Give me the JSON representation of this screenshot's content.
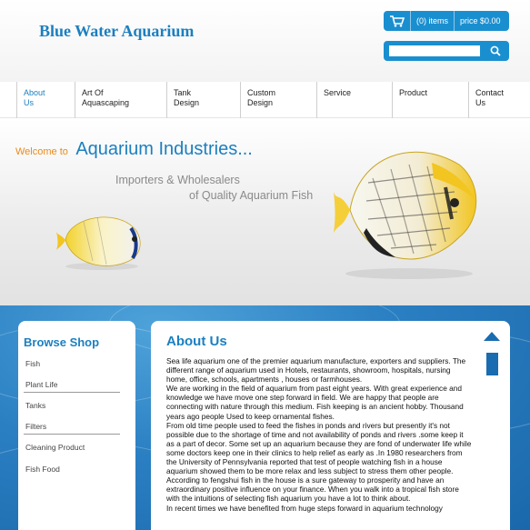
{
  "header": {
    "logo": "Blue Water Aquarium",
    "cart_items": "(0) items",
    "cart_price": "price $0.00",
    "search_placeholder": ""
  },
  "nav": {
    "items": [
      {
        "label_line1": "About",
        "label_line2": "Us"
      },
      {
        "label_line1": "Art Of",
        "label_line2": "Aquascaping"
      },
      {
        "label_line1": "Tank",
        "label_line2": "Design"
      },
      {
        "label_line1": "Custom",
        "label_line2": "Design"
      },
      {
        "label_line1": "Service",
        "label_line2": ""
      },
      {
        "label_line1": "Product",
        "label_line2": ""
      },
      {
        "label_line1": "Contact",
        "label_line2": "Us"
      }
    ]
  },
  "banner": {
    "welcome_small": "Welcome to",
    "welcome_big": "Aquarium Industries...",
    "tagline1": "Importers & Wholesalers",
    "tagline2": "of Quality Aquarium Fish"
  },
  "sidebar": {
    "title": "Browse Shop",
    "items": [
      "Fish",
      "Plant Life",
      "Tanks",
      "Filters",
      "Cleaning Product",
      "Fish Food"
    ]
  },
  "content": {
    "title": "About Us",
    "paragraphs": [
      "Sea life aquarium one of the premier aquarium manufacture, exporters and suppliers. The different range of aquarium used in Hotels, restaurants, showroom, hospitals, nursing home, office, schools, apartments , houses or farmhouses.",
      "We are working in the field of aquarium from past eight years. With great experience and knowledge we have move one step forward in field. We are happy that people are connecting with nature through this medium. Fish keeping is an ancient hobby. Thousand years ago people Used to keep ornamental fishes.",
      "From old time people used to feed the fishes in ponds and rivers but presently it's not possible due to the shortage of time and not availability of ponds and rivers .some keep it as a part of decor. Some set up an aquarium because they are fond of underwater life while some doctors keep one in their clinics to help relief as early as .In 1980 researchers from the University of Pennsylvania reported that test of people watching fish in a house aquarium showed them to be more relax and less subject to stress them other people. According to fengshui fish in the house is a sure gateway to prosperity and have an extraordinary positive influence on your finance. When you walk into a tropical fish store with the intuitions of selecting fish aquarium you have a lot to think about.",
      "In recent times we have benefited from huge steps forward in aquarium technology"
    ]
  },
  "colors": {
    "brand_blue": "#1b7fc0",
    "accent_orange": "#e88b1a",
    "cart_blue": "#1a8fd0"
  }
}
